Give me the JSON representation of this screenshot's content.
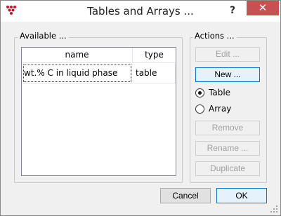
{
  "window": {
    "title": "Tables and Arrays ...",
    "help_glyph": "?",
    "close_glyph": "✕",
    "close_color": "#c75050"
  },
  "available": {
    "label": "Available ...",
    "columns": [
      "name",
      "type"
    ],
    "rows": [
      {
        "name": "wt.% C in liquid phase",
        "type": "table"
      }
    ]
  },
  "actions": {
    "label": "Actions ...",
    "edit": "Edit ...",
    "new": "New ...",
    "radio_table": "Table",
    "radio_array": "Array",
    "selected_type": "Table",
    "remove": "Remove",
    "rename": "Rename ...",
    "duplicate": "Duplicate"
  },
  "footer": {
    "cancel": "Cancel",
    "ok": "OK"
  },
  "icons": {
    "app": "red-dots-icon",
    "help": "help-icon",
    "close": "close-icon",
    "grip": "resize-grip-icon"
  },
  "colors": {
    "focus_blue": "#0078d7",
    "app_icon_red": "#c8102e"
  }
}
